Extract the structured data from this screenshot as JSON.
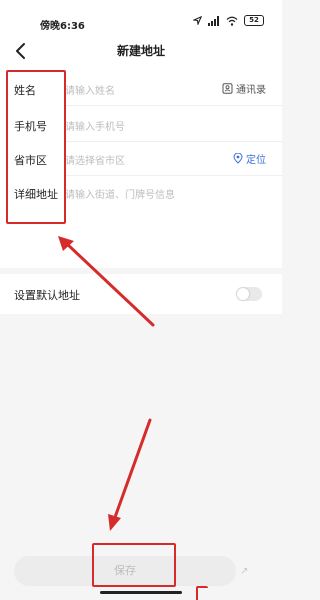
{
  "status_bar": {
    "time": "傍晚6:36",
    "battery": "52"
  },
  "header": {
    "title": "新建地址"
  },
  "form": {
    "name": {
      "label": "姓名",
      "placeholder": "请输入姓名",
      "action": "通讯录"
    },
    "phone": {
      "label": "手机号",
      "placeholder": "请输入手机号"
    },
    "region": {
      "label": "省市区",
      "placeholder": "请选择省市区",
      "action": "定位"
    },
    "address": {
      "label": "详细地址",
      "placeholder": "请输入街道、门牌号信息"
    }
  },
  "default_address": {
    "label": "设置默认地址",
    "enabled": false
  },
  "footer": {
    "save_label": "保存"
  },
  "colors": {
    "accent": "#3b6fd8",
    "annotation": "#d62b2b"
  }
}
